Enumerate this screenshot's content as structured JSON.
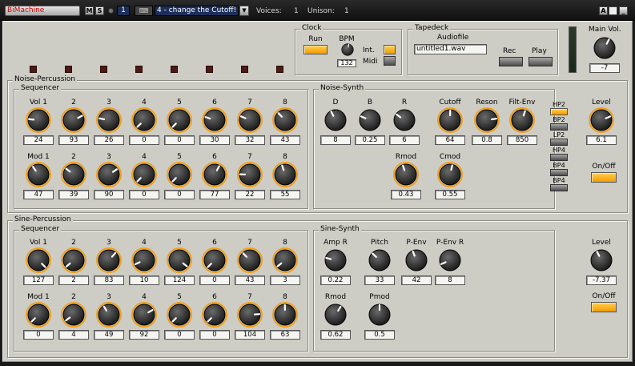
{
  "titlebar": {
    "app_name": "BiMachine",
    "m_label": "M",
    "s_label": "S",
    "channel": "1",
    "icon": "keyboard-icon",
    "preset": "4 - change the Cutoff!",
    "voices_label": "Voices:",
    "voices_value": "1",
    "unison_label": "Unison:",
    "unison_value": "1",
    "a_label": "A",
    "min_label": "_"
  },
  "clock": {
    "title": "Clock",
    "run_label": "Run",
    "bpm_label": "BPM",
    "bpm_value": "132",
    "int_label": "Int.",
    "midi_label": "Midi"
  },
  "tapedeck": {
    "title": "Tapedeck",
    "audiofile_label": "Audiofile",
    "file_value": "untitled1.wav",
    "rec_label": "Rec",
    "play_label": "Play"
  },
  "master": {
    "label": "Main Vol.",
    "value": "-7"
  },
  "noise": {
    "title": "Noise-Percussion",
    "sequencer": {
      "title": "Sequencer",
      "vol_labels": [
        "Vol  1",
        "2",
        "3",
        "4",
        "5",
        "6",
        "7",
        "8"
      ],
      "vol_values": [
        "24",
        "93",
        "26",
        "0",
        "0",
        "30",
        "32",
        "43"
      ],
      "mod_labels": [
        "Mod  1",
        "2",
        "3",
        "4",
        "5",
        "6",
        "7",
        "8"
      ],
      "mod_values": [
        "47",
        "39",
        "90",
        "0",
        "0",
        "77",
        "22",
        "55"
      ]
    },
    "synth": {
      "title": "Noise-Synth",
      "row1_labels": [
        "D",
        "B",
        "R",
        "Cutoff",
        "Reson",
        "Filt-Env"
      ],
      "row1_values": [
        "8",
        "0.25",
        "6",
        "64",
        "0.8",
        "850"
      ],
      "row2_labels": [
        "Rmod",
        "Cmod"
      ],
      "row2_values": [
        "0.43",
        "0.55"
      ],
      "filters": [
        "HP2",
        "BP2",
        "LP2",
        "HP4",
        "BP4",
        "BP4"
      ]
    },
    "level_label": "Level",
    "level_value": "6.1",
    "onoff_label": "On/Off"
  },
  "sine": {
    "title": "Sine-Percussion",
    "sequencer": {
      "title": "Sequencer",
      "vol_labels": [
        "Vol  1",
        "2",
        "3",
        "4",
        "5",
        "6",
        "7",
        "8"
      ],
      "vol_values": [
        "127",
        "2",
        "83",
        "10",
        "124",
        "0",
        "43",
        "3"
      ],
      "mod_labels": [
        "Mod  1",
        "2",
        "3",
        "4",
        "5",
        "6",
        "7",
        "8"
      ],
      "mod_values": [
        "0",
        "4",
        "49",
        "92",
        "0",
        "0",
        "104",
        "63"
      ]
    },
    "synth": {
      "title": "Sine-Synth",
      "row1_labels": [
        "Amp R",
        "Pitch",
        "P-Env",
        "P-Env R"
      ],
      "row1_values": [
        "0.22",
        "33",
        "42",
        "8"
      ],
      "row2_labels": [
        "Rmod",
        "Pmod"
      ],
      "row2_values": [
        "0.62",
        "0.5"
      ]
    },
    "level_label": "Level",
    "level_value": "-7.37",
    "onoff_label": "On/Off"
  },
  "colors": {
    "accent": "#f39c00",
    "panel": "#cdccc5",
    "led_off": "#4a1a14"
  }
}
